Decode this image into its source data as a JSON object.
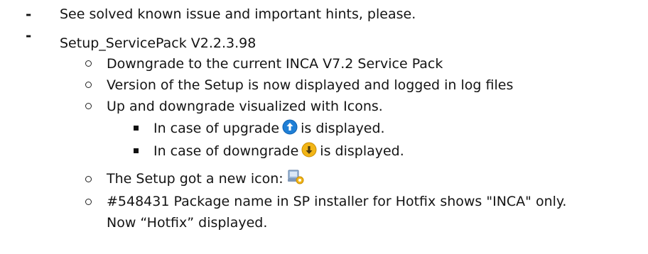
{
  "items": {
    "l1": "See solved known issue and important hints, please.",
    "l2": "Setup_ServicePack V2.2.3.98",
    "l3": "Downgrade to the current INCA V7.2 Service Pack",
    "l4": "Version of the Setup is now displayed and logged in log files",
    "l5": "Up and downgrade visualized with Icons.",
    "l6_pre": "In case of upgrade",
    "l6_post": "is displayed.",
    "l7_pre": "In case of downgrade",
    "l7_post": "is displayed.",
    "l8": "The Setup got a new icon:",
    "l9": "#548431 Package name in SP installer for Hotfix shows \"INCA\" only.",
    "l10": "Now “Hotfix” displayed."
  },
  "icons": {
    "upgrade": "upgrade-arrow-icon",
    "downgrade": "downgrade-arrow-icon",
    "setup": "setup-installer-icon"
  },
  "colors": {
    "upgrade_blue": "#1f7fd6",
    "downgrade_yellow": "#f2b516",
    "text": "#141414"
  }
}
